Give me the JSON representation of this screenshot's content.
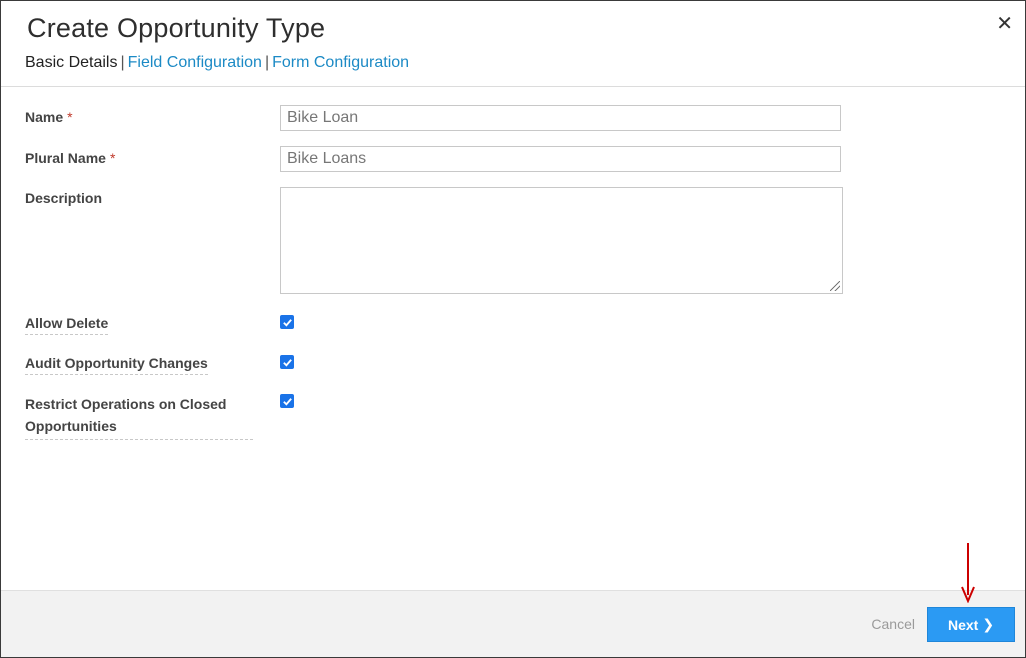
{
  "header": {
    "title": "Create Opportunity Type",
    "close_icon": "close-icon",
    "tabs": [
      {
        "label": "Basic Details",
        "active": true
      },
      {
        "label": "Field Configuration",
        "active": false
      },
      {
        "label": "Form Configuration",
        "active": false
      }
    ],
    "separator": "|"
  },
  "form": {
    "name": {
      "label": "Name",
      "required_mark": "*",
      "value": "Bike Loan"
    },
    "plural_name": {
      "label": "Plural Name",
      "required_mark": "*",
      "value": "Bike Loans"
    },
    "description": {
      "label": "Description",
      "value": ""
    },
    "allow_delete": {
      "label": "Allow Delete",
      "checked": true
    },
    "audit_changes": {
      "label": "Audit Opportunity Changes",
      "checked": true
    },
    "restrict_operations": {
      "label_line1": "Restrict Operations on Closed",
      "label_line2": "Opportunities",
      "checked": true
    }
  },
  "footer": {
    "cancel_label": "Cancel",
    "next_label": "Next",
    "next_icon": "chevron-right-icon"
  },
  "colors": {
    "accent": "#2b9af3",
    "link": "#1c8ac5",
    "required": "#c0392b",
    "annotation_arrow": "#cc0000"
  }
}
